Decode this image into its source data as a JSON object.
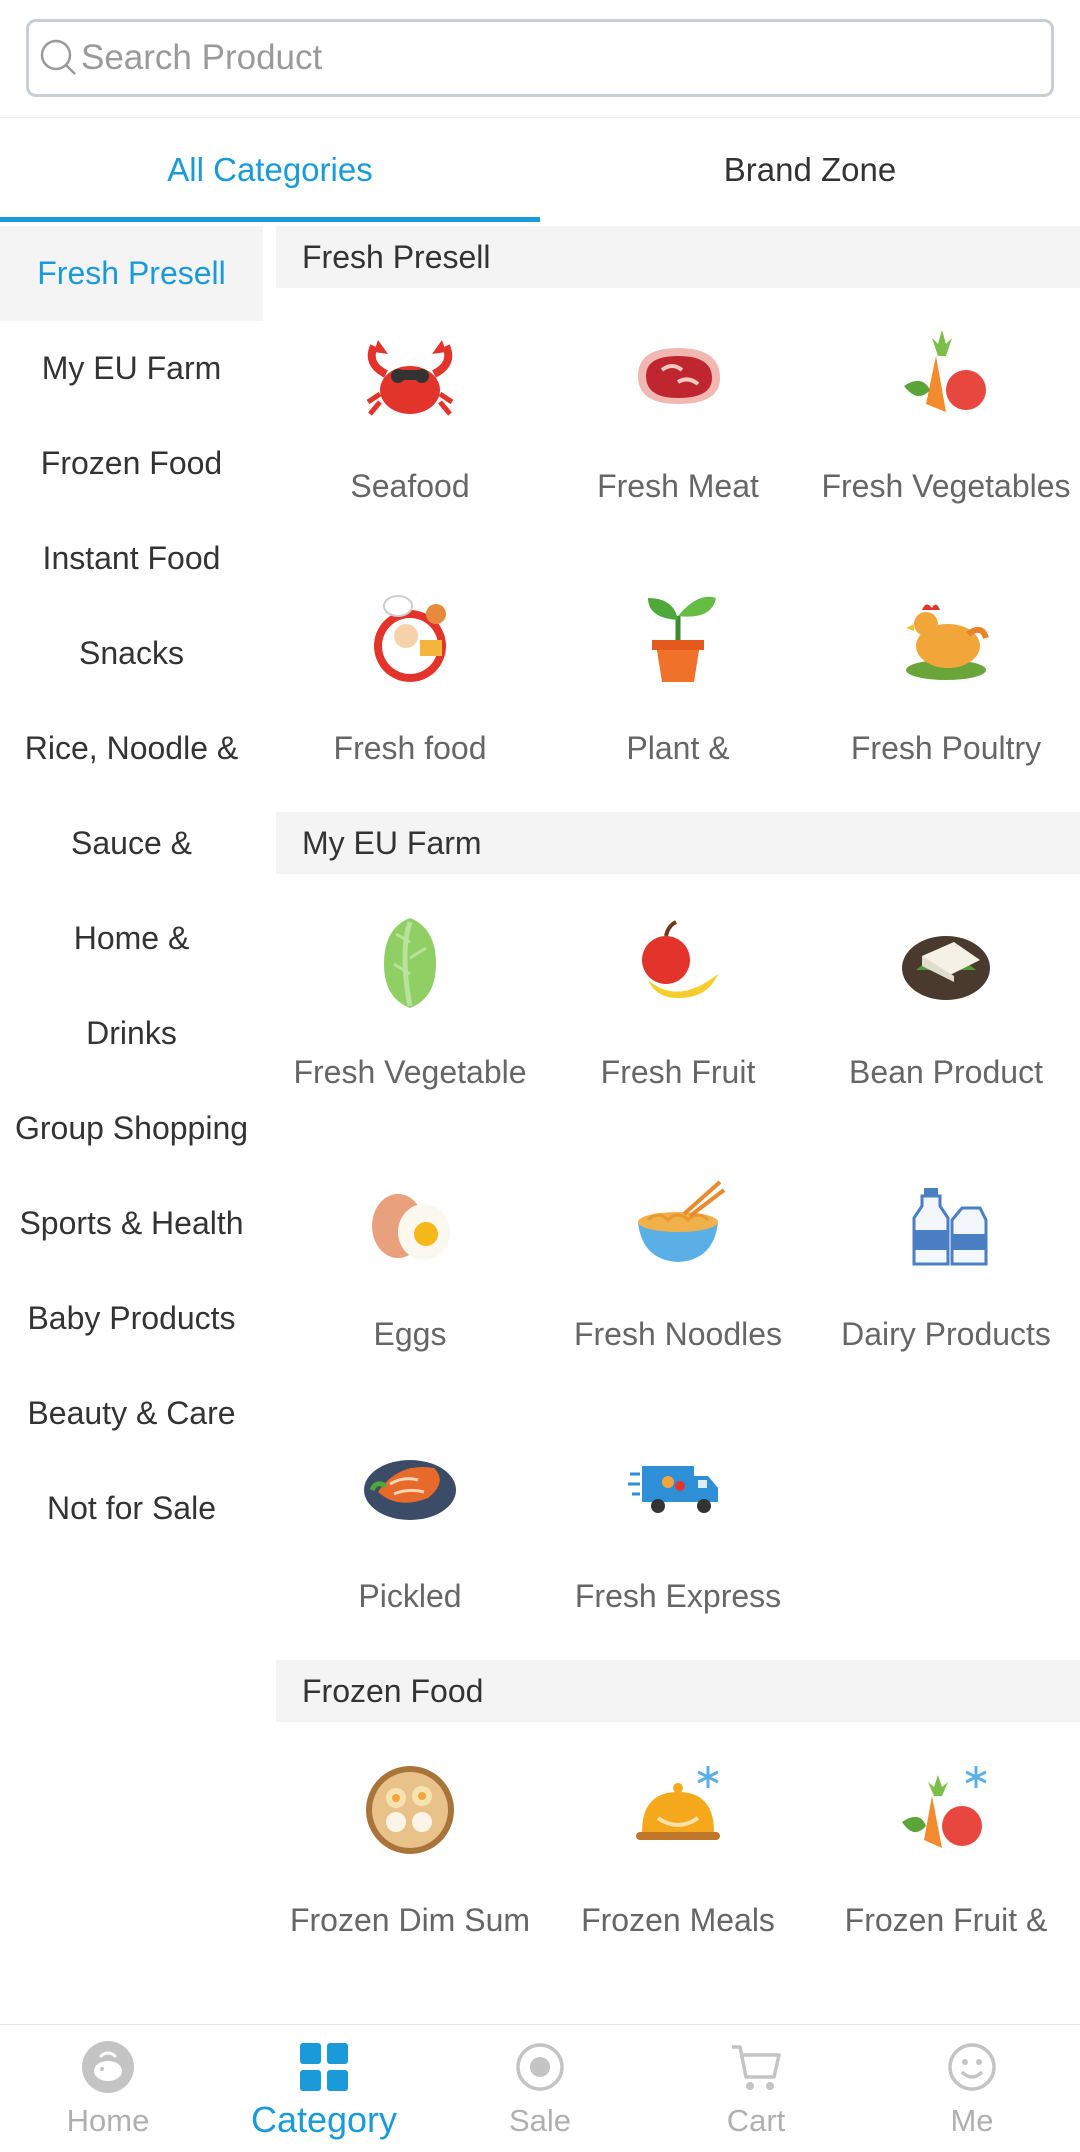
{
  "search": {
    "placeholder": "Search Product"
  },
  "tabs": [
    {
      "label": "All Categories",
      "active": true
    },
    {
      "label": "Brand Zone",
      "active": false
    }
  ],
  "sidebar": {
    "items": [
      {
        "label": "Fresh Presell",
        "active": true
      },
      {
        "label": "My EU Farm"
      },
      {
        "label": "Frozen Food"
      },
      {
        "label": "Instant Food"
      },
      {
        "label": "Snacks"
      },
      {
        "label": "Rice, Noodle &"
      },
      {
        "label": "Sauce &"
      },
      {
        "label": "Home &"
      },
      {
        "label": "Drinks"
      },
      {
        "label": "Group Shopping"
      },
      {
        "label": "Sports & Health"
      },
      {
        "label": "Baby Products"
      },
      {
        "label": "Beauty & Care"
      },
      {
        "label": "Not for Sale"
      }
    ]
  },
  "sections": [
    {
      "title": "Fresh Presell",
      "items": [
        {
          "label": "Seafood",
          "icon": "crab-icon"
        },
        {
          "label": "Fresh Meat",
          "icon": "meat-icon"
        },
        {
          "label": "Fresh Vegetables",
          "icon": "vegetables-icon"
        },
        {
          "label": "Fresh food",
          "icon": "chef-icon"
        },
        {
          "label": "Plant &",
          "icon": "plant-icon"
        },
        {
          "label": "Fresh Poultry",
          "icon": "hen-icon"
        }
      ]
    },
    {
      "title": "My EU Farm",
      "items": [
        {
          "label": "Fresh Vegetable",
          "icon": "cabbage-icon"
        },
        {
          "label": "Fresh Fruit",
          "icon": "apple-banana-icon"
        },
        {
          "label": "Bean Product",
          "icon": "tofu-icon"
        },
        {
          "label": "Eggs",
          "icon": "egg-icon"
        },
        {
          "label": "Fresh Noodles",
          "icon": "noodle-bowl-icon"
        },
        {
          "label": "Dairy Products",
          "icon": "milk-icon"
        },
        {
          "label": "Pickled",
          "icon": "kimchi-icon"
        },
        {
          "label": "Fresh Express",
          "icon": "delivery-truck-icon"
        }
      ]
    },
    {
      "title": "Frozen Food",
      "items": [
        {
          "label": "Frozen Dim Sum",
          "icon": "dim-sum-icon"
        },
        {
          "label": "Frozen Meals",
          "icon": "frozen-meal-icon"
        },
        {
          "label": "Frozen Fruit &",
          "icon": "frozen-produce-icon"
        }
      ]
    }
  ],
  "bottom_nav": [
    {
      "label": "Home",
      "icon": "home-icon",
      "active": false
    },
    {
      "label": "Category",
      "icon": "category-grid-icon",
      "active": true
    },
    {
      "label": "Sale",
      "icon": "sale-icon",
      "active": false
    },
    {
      "label": "Cart",
      "icon": "cart-icon",
      "active": false
    },
    {
      "label": "Me",
      "icon": "smile-icon",
      "active": false
    }
  ],
  "colors": {
    "accent": "#1a9ad9",
    "section_bg": "#f4f4f4",
    "inactive_nav": "#b0b0b0"
  }
}
